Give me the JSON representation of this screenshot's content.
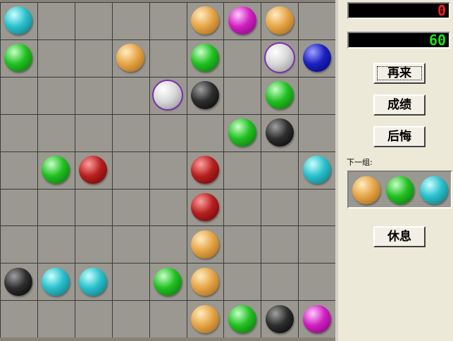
{
  "colors": {
    "cyan": [
      "#c8ffff",
      "#2ac0cc",
      "#0a6f78"
    ],
    "orange": [
      "#ffecc0",
      "#e6a548",
      "#9a6010"
    ],
    "magenta": [
      "#ffc8ff",
      "#d020c0",
      "#7a0070"
    ],
    "green": [
      "#c8ffc8",
      "#22c022",
      "#0a6a0a"
    ],
    "white": [
      "#ffffff",
      "#d8d8d8",
      "#8a8a8a"
    ],
    "blue": [
      "#a0a0ff",
      "#1a22c0",
      "#00006a"
    ],
    "black": [
      "#a0a0a0",
      "#2e2e2e",
      "#000000"
    ],
    "red": [
      "#ffa0a0",
      "#b82020",
      "#600000"
    ]
  },
  "board": {
    "rows": 9,
    "cols": 9,
    "balls": [
      {
        "r": 0,
        "c": 0,
        "color": "cyan"
      },
      {
        "r": 0,
        "c": 5,
        "color": "orange"
      },
      {
        "r": 0,
        "c": 6,
        "color": "magenta"
      },
      {
        "r": 0,
        "c": 7,
        "color": "orange"
      },
      {
        "r": 1,
        "c": 0,
        "color": "green"
      },
      {
        "r": 1,
        "c": 3,
        "color": "orange"
      },
      {
        "r": 1,
        "c": 5,
        "color": "green"
      },
      {
        "r": 1,
        "c": 7,
        "color": "white",
        "selected": true
      },
      {
        "r": 1,
        "c": 8,
        "color": "blue"
      },
      {
        "r": 2,
        "c": 4,
        "color": "white",
        "selected": true
      },
      {
        "r": 2,
        "c": 5,
        "color": "black"
      },
      {
        "r": 2,
        "c": 7,
        "color": "green"
      },
      {
        "r": 3,
        "c": 6,
        "color": "green"
      },
      {
        "r": 3,
        "c": 7,
        "color": "black"
      },
      {
        "r": 4,
        "c": 1,
        "color": "green"
      },
      {
        "r": 4,
        "c": 2,
        "color": "red"
      },
      {
        "r": 4,
        "c": 5,
        "color": "red"
      },
      {
        "r": 4,
        "c": 8,
        "color": "cyan"
      },
      {
        "r": 5,
        "c": 5,
        "color": "red"
      },
      {
        "r": 6,
        "c": 5,
        "color": "orange"
      },
      {
        "r": 7,
        "c": 0,
        "color": "black"
      },
      {
        "r": 7,
        "c": 1,
        "color": "cyan"
      },
      {
        "r": 7,
        "c": 2,
        "color": "cyan"
      },
      {
        "r": 7,
        "c": 4,
        "color": "green"
      },
      {
        "r": 7,
        "c": 5,
        "color": "orange"
      },
      {
        "r": 8,
        "c": 5,
        "color": "orange"
      },
      {
        "r": 8,
        "c": 6,
        "color": "green"
      },
      {
        "r": 8,
        "c": 7,
        "color": "black"
      },
      {
        "r": 8,
        "c": 8,
        "color": "magenta"
      }
    ]
  },
  "panel": {
    "score": "0",
    "timer": "60",
    "buttons": {
      "restart": "再来",
      "scores": "成绩",
      "undo": "后悔",
      "rest": "休息"
    },
    "next_label": "下一组:",
    "next_balls": [
      "orange",
      "green",
      "cyan"
    ]
  }
}
